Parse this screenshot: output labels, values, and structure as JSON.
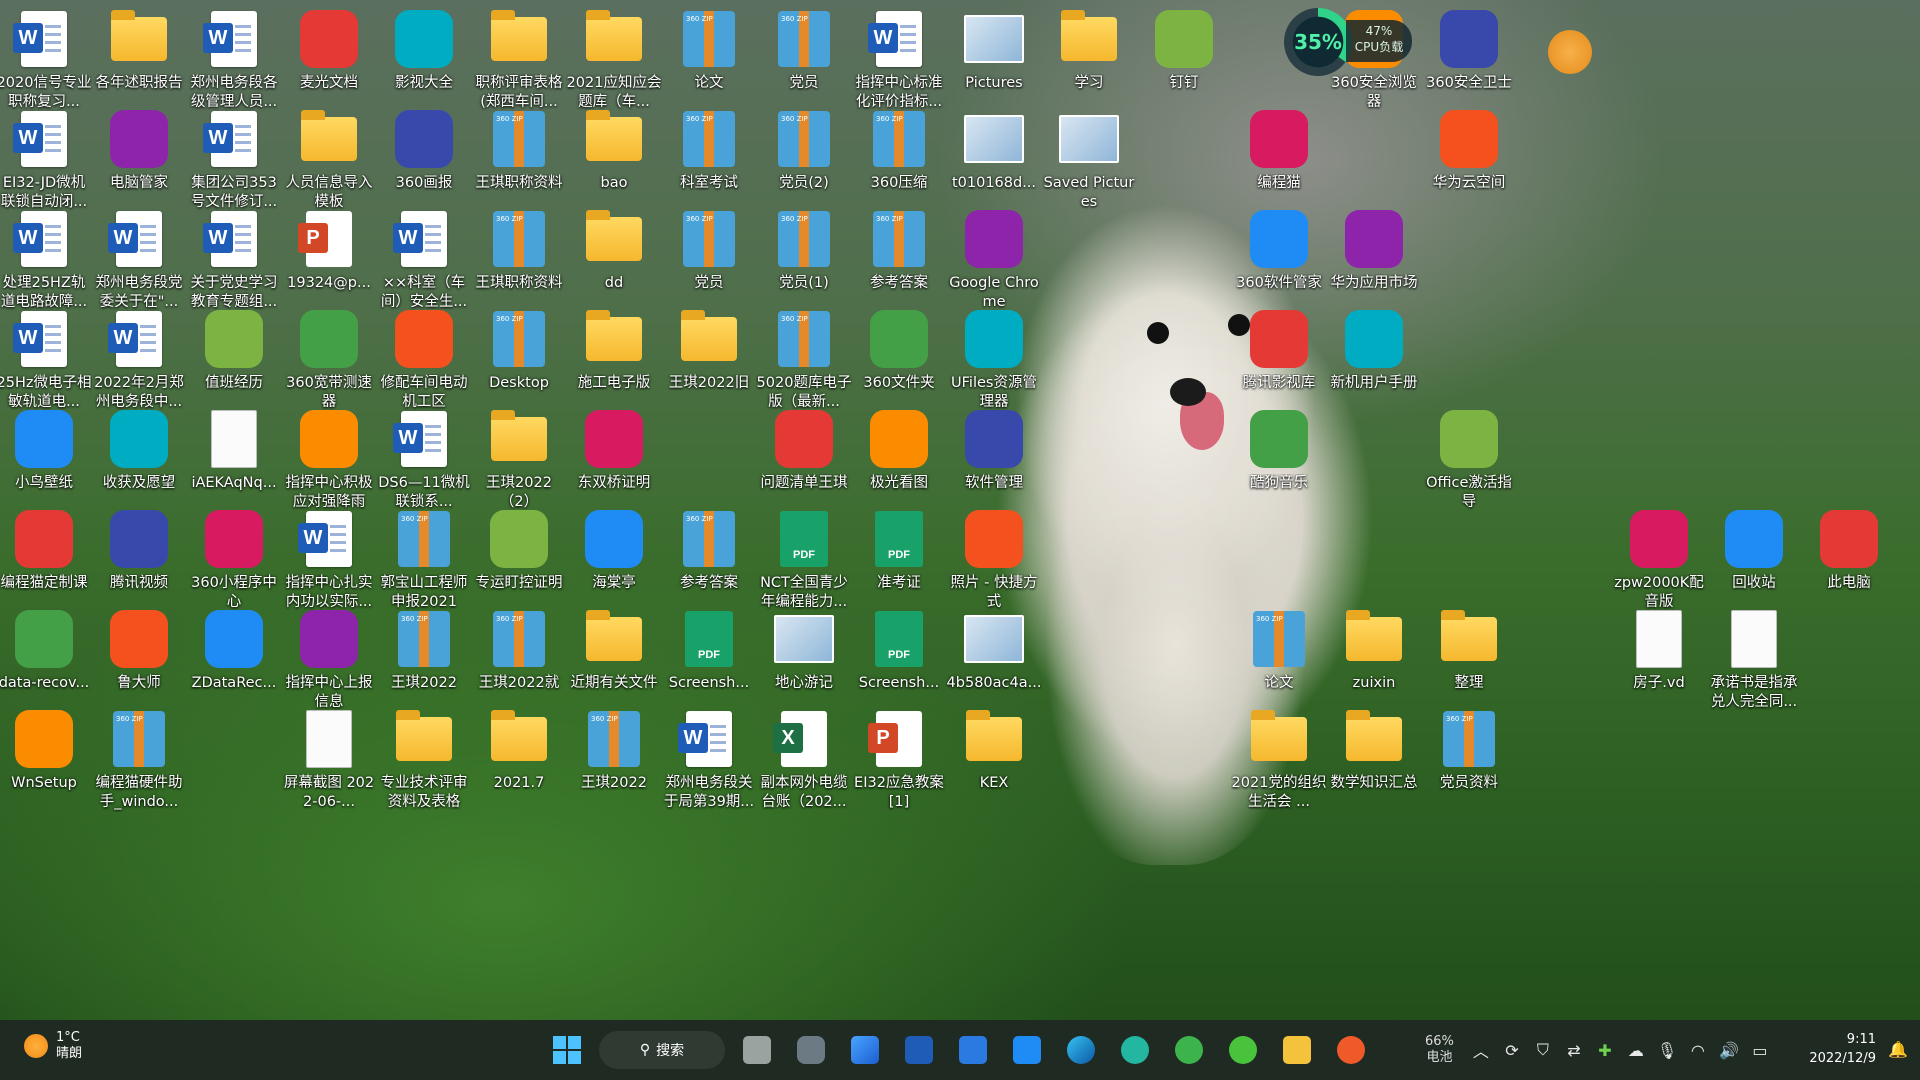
{
  "desktop": {
    "columns": [
      [
        "2020信号专业职称复习...",
        "EI32-JD微机联锁自动闭...",
        "处理25HZ轨道电路故障...",
        "25Hz微电子相敏轨道电...",
        "小鸟壁纸",
        "编程猫定制课",
        "data-recov...",
        "WnSetup"
      ],
      [
        "各年述职报告",
        "电脑管家",
        "郑州电务段党委关于在\"...",
        "2022年2月郑州电务段中...",
        "收获及愿望",
        "腾讯视频",
        "鲁大师",
        "编程猫硬件助手_windo..."
      ],
      [
        "郑州电务段各级管理人员...",
        "集团公司353号文件修订...",
        "关于党史学习教育专题组...",
        "值班经历",
        "iAEKAqNq...",
        "360小程序中心",
        "ZDataRec...",
        ""
      ],
      [
        "麦光文档",
        "人员信息导入模板",
        "19324@p...",
        "360宽带测速器",
        "指挥中心积极应对强降雨",
        "指挥中心扎实内功以实际...",
        "指挥中心上报信息",
        "屏幕截图 2022-06-..."
      ],
      [
        "影视大全",
        "360画报",
        "××科室（车间）安全生...",
        "修配车间电动机工区",
        "DS6—11微机联锁系...",
        "郭宝山工程师申报2021",
        "王琪2022",
        "专业技术评审资料及表格"
      ],
      [
        "职称评审表格(郑西车间...",
        "王琪职称资料",
        "王琪职称资料",
        "Desktop",
        "王琪2022（2）",
        "专运盯控证明",
        "王琪2022就",
        "2021.7"
      ],
      [
        "2021应知应会题库（车...",
        "bao",
        "dd",
        "施工电子版",
        "东双桥证明",
        "海棠亭",
        "近期有关文件",
        "王琪2022"
      ],
      [
        "论文",
        "科室考试",
        "党员",
        "王琪2022旧",
        "",
        "参考答案",
        "Screensh...",
        "郑州电务段关于局第39期..."
      ],
      [
        "党员",
        "党员(2)",
        "党员(1)",
        "5020题库电子版（最新...",
        "问题清单王琪",
        "NCT全国青少年编程能力...",
        "地心游记",
        "副本网外电缆台账（202..."
      ],
      [
        "指挥中心标准化评价指标...",
        "360压缩",
        "参考答案",
        "360文件夹",
        "极光看图",
        "准考证",
        "Screensh...",
        "EI32应急教案[1]"
      ],
      [
        "Pictures",
        "t010168d...",
        "Google Chrome",
        "UFiles资源管理器",
        "软件管理",
        "照片 - 快捷方式",
        "4b580ac4a...",
        "KEX"
      ],
      [
        "学习",
        "Saved Pictures",
        "",
        "",
        "",
        "",
        "",
        ""
      ],
      [
        "钉钉",
        "",
        "",
        "",
        "",
        "",
        "",
        ""
      ],
      [
        "",
        "编程猫",
        "360软件管家",
        "腾讯影视库",
        "酷狗音乐",
        "",
        "论文",
        "2021党的组织生活会 ..."
      ],
      [
        "360安全浏览器",
        "",
        "华为应用市场",
        "新机用户手册",
        "",
        "",
        "zuixin",
        "数学知识汇总"
      ],
      [
        "360安全卫士",
        "华为云空间",
        "",
        "",
        "Office激活指导",
        "",
        "整理",
        "党员资料"
      ],
      [
        "",
        "",
        "",
        "",
        "",
        "zpw2000K配音版",
        "房子.vd",
        ""
      ],
      [
        "",
        "",
        "",
        "",
        "",
        "回收站",
        "承诺书是指承兑人完全同...",
        ""
      ],
      [
        "",
        "",
        "",
        "",
        "",
        "此电脑",
        "",
        ""
      ]
    ]
  },
  "cpu_widget": {
    "percent": "35%",
    "load_percent": "47%",
    "load_label": "CPU负载"
  },
  "taskbar": {
    "weather_temp": "1°C",
    "weather_desc": "晴朗",
    "search_label": "搜索",
    "battery_percent": "66%",
    "battery_label": "电池",
    "time": "9:11",
    "date": "2022/12/9"
  }
}
